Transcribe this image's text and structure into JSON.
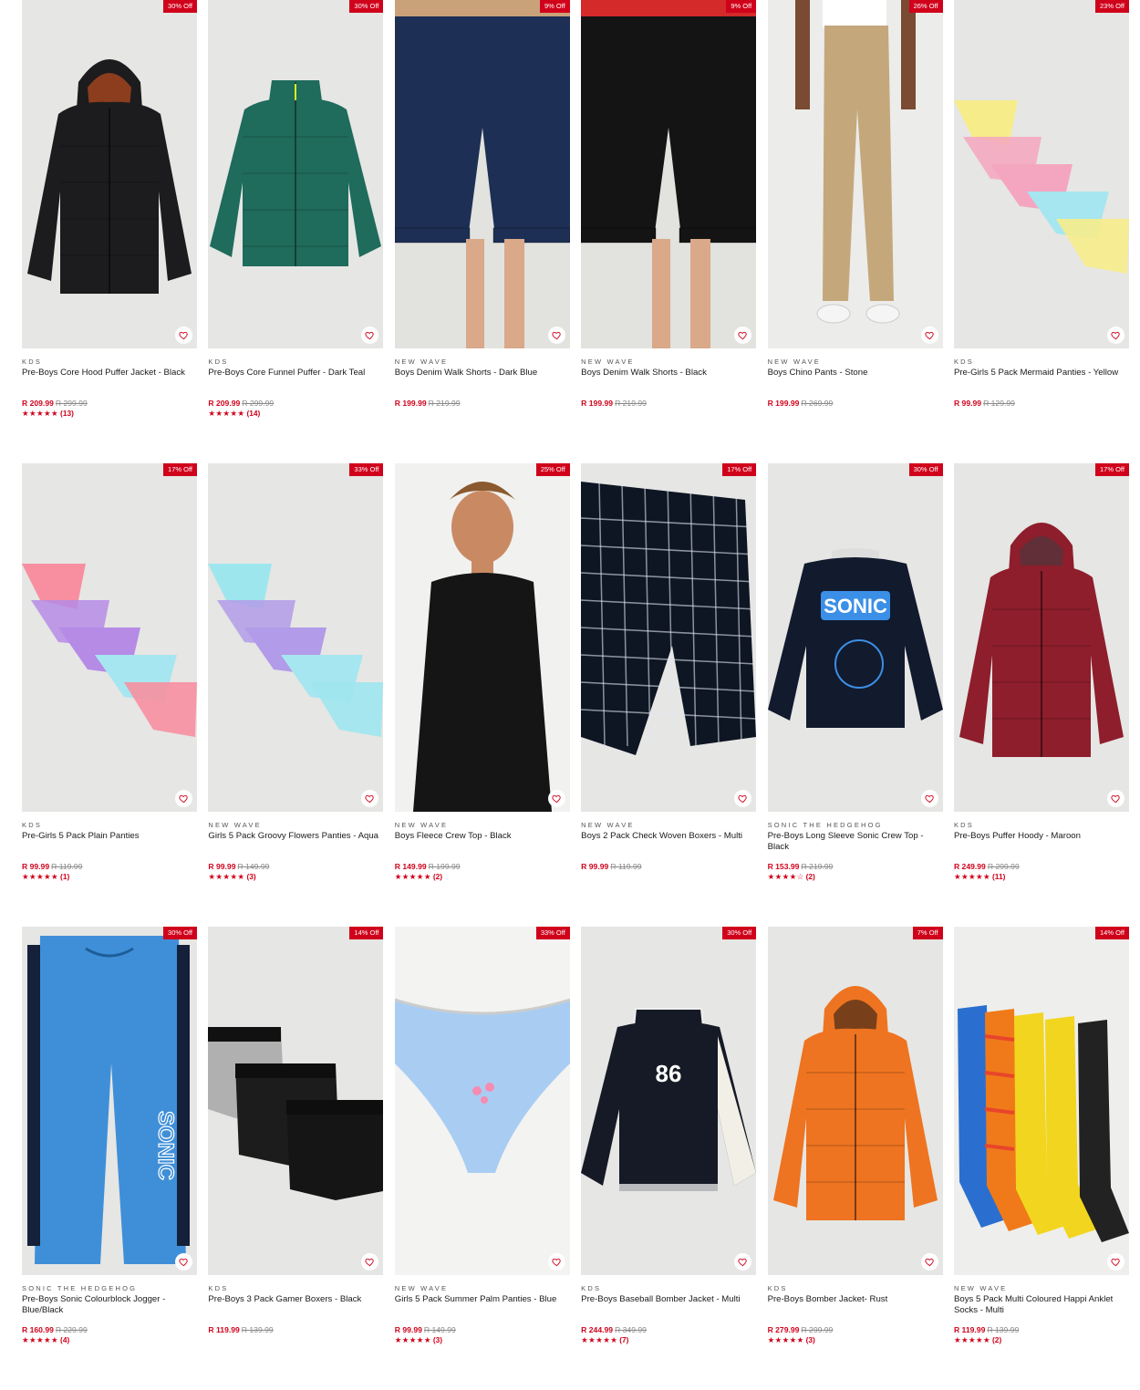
{
  "products": [
    {
      "badge": "30% Off",
      "brand": "KDS",
      "name": "Pre-Boys Core Hood Puffer Jacket - Black",
      "price": "R 209.99",
      "was": "R 299.99",
      "stars": "★★★★★",
      "reviews": "(13)",
      "colors": {
        "bg": "#e6e6e4",
        "item": "#1c1c1e",
        "accent": "#e85a1e"
      },
      "kind": "jacket-hood"
    },
    {
      "badge": "30% Off",
      "brand": "KDS",
      "name": "Pre-Boys Core Funnel Puffer - Dark Teal",
      "price": "R 209.99",
      "was": "R 299.99",
      "stars": "★★★★★",
      "reviews": "(14)",
      "colors": {
        "bg": "#e6e6e4",
        "item": "#1f6b5c",
        "accent": "#d7ef1b"
      },
      "kind": "jacket"
    },
    {
      "badge": "9% Off",
      "brand": "NEW WAVE",
      "name": "Boys Denim Walk Shorts - Dark Blue",
      "price": "R 199.99",
      "was": "R 219.99",
      "stars": "",
      "reviews": "",
      "colors": {
        "bg": "#e2e2de",
        "item": "#1e2f55",
        "accent": "#c9a27a"
      },
      "kind": "shorts"
    },
    {
      "badge": "9% Off",
      "brand": "NEW WAVE",
      "name": "Boys Denim Walk Shorts - Black",
      "price": "R 199.99",
      "was": "R 219.99",
      "stars": "",
      "reviews": "",
      "colors": {
        "bg": "#e2e2de",
        "item": "#141414",
        "accent": "#d42a2a"
      },
      "kind": "shorts"
    },
    {
      "badge": "26% Off",
      "brand": "NEW WAVE",
      "name": "Boys Chino Pants - Stone",
      "price": "R 199.99",
      "was": "R 269.99",
      "stars": "",
      "reviews": "",
      "colors": {
        "bg": "#ececea",
        "item": "#c4a87c",
        "accent": "#7a4a32"
      },
      "kind": "pants"
    },
    {
      "badge": "23% Off",
      "brand": "KDS",
      "name": "Pre-Girls 5 Pack Mermaid Panties - Yellow",
      "price": "R 99.99",
      "was": "R 129.99",
      "stars": "",
      "reviews": "",
      "colors": {
        "bg": "#e6e6e4",
        "item": "#f4a6c0",
        "accent": "#f6ec8a"
      },
      "kind": "panties"
    },
    {
      "badge": "17% Off",
      "brand": "KDS",
      "name": "Pre-Girls 5 Pack Plain Panties",
      "price": "R 99.99",
      "was": "R 119.99",
      "stars": "★★★★★",
      "reviews": "(1)",
      "colors": {
        "bg": "#e6e6e4",
        "item": "#b58be6",
        "accent": "#f78fa0"
      },
      "kind": "panties"
    },
    {
      "badge": "33% Off",
      "brand": "NEW WAVE",
      "name": "Girls 5 Pack Groovy Flowers Panties - Aqua",
      "price": "R 99.99",
      "was": "R 149.99",
      "stars": "★★★★★",
      "reviews": "(3)",
      "colors": {
        "bg": "#e6e6e4",
        "item": "#b29be8",
        "accent": "#9ee6ee"
      },
      "kind": "panties"
    },
    {
      "badge": "25% Off",
      "brand": "NEW WAVE",
      "name": "Boys Fleece Crew Top - Black",
      "price": "R 149.99",
      "was": "R 199.99",
      "stars": "★★★★★",
      "reviews": "(2)",
      "colors": {
        "bg": "#f1f1ef",
        "item": "#151515",
        "accent": "#c98a63"
      },
      "kind": "crew"
    },
    {
      "badge": "17% Off",
      "brand": "NEW WAVE",
      "name": "Boys 2 Pack Check Woven Boxers - Multi",
      "price": "R 99.99",
      "was": "R 119.99",
      "stars": "",
      "reviews": "",
      "colors": {
        "bg": "#e6e6e4",
        "item": "#0e1624",
        "accent": "#dfe6ee"
      },
      "kind": "boxers"
    },
    {
      "badge": "30% Off",
      "brand": "SONIC THE HEDGEHOG",
      "name": "Pre-Boys Long Sleeve Sonic Crew Top - Black",
      "price": "R 153.99",
      "was": "R 219.99",
      "stars": "★★★★☆",
      "reviews": "(2)",
      "colors": {
        "bg": "#e6e6e4",
        "item": "#121a2e",
        "accent": "#3b8fe6"
      },
      "kind": "sweater"
    },
    {
      "badge": "17% Off",
      "brand": "KDS",
      "name": "Pre-Boys Puffer Hoody - Maroon",
      "price": "R 249.99",
      "was": "R 299.99",
      "stars": "★★★★★",
      "reviews": "(11)",
      "colors": {
        "bg": "#e6e6e4",
        "item": "#8e1e2c",
        "accent": "#3a3e44"
      },
      "kind": "jacket-hood"
    },
    {
      "badge": "30% Off",
      "brand": "SONIC THE HEDGEHOG",
      "name": "Pre-Boys Sonic Colourblock Jogger - Blue/Black",
      "price": "R 160.99",
      "was": "R 229.99",
      "stars": "★★★★★",
      "reviews": "(4)",
      "colors": {
        "bg": "#e6e6e4",
        "item": "#3f8fd8",
        "accent": "#15203a"
      },
      "kind": "jogger"
    },
    {
      "badge": "14% Off",
      "brand": "KDS",
      "name": "Pre-Boys 3 Pack Gamer Boxers - Black",
      "price": "R 119.99",
      "was": "R 139.99",
      "stars": "",
      "reviews": "",
      "colors": {
        "bg": "#e6e6e4",
        "item": "#151515",
        "accent": "#b0b0b0"
      },
      "kind": "boxers-stack"
    },
    {
      "badge": "33% Off",
      "brand": "NEW WAVE",
      "name": "Girls 5 Pack Summer Palm Panties - Blue",
      "price": "R 99.99",
      "was": "R 149.99",
      "stars": "★★★★★",
      "reviews": "(3)",
      "colors": {
        "bg": "#f3f3f1",
        "item": "#a9cdf2",
        "accent": "#f58bb0"
      },
      "kind": "panty-single"
    },
    {
      "badge": "30% Off",
      "brand": "KDS",
      "name": "Pre-Boys Baseball Bomber Jacket - Multi",
      "price": "R 244.99",
      "was": "R 349.99",
      "stars": "★★★★★",
      "reviews": "(7)",
      "colors": {
        "bg": "#e6e6e4",
        "item": "#151a26",
        "accent": "#f2efe6"
      },
      "kind": "bomber"
    },
    {
      "badge": "7% Off",
      "brand": "KDS",
      "name": "Pre-Boys Bomber Jacket- Rust",
      "price": "R 279.99",
      "was": "R 299.99",
      "stars": "★★★★★",
      "reviews": "(3)",
      "colors": {
        "bg": "#e6e6e4",
        "item": "#ee7421",
        "accent": "#161616"
      },
      "kind": "jacket-hood"
    },
    {
      "badge": "14% Off",
      "brand": "NEW WAVE",
      "name": "Boys 5 Pack Multi Coloured Happi Anklet Socks - Multi",
      "price": "R 119.99",
      "was": "R 139.99",
      "stars": "★★★★★",
      "reviews": "(2)",
      "colors": {
        "bg": "#eeeeec",
        "item": "#f2d51e",
        "accent": "#e8452a"
      },
      "kind": "socks"
    }
  ]
}
